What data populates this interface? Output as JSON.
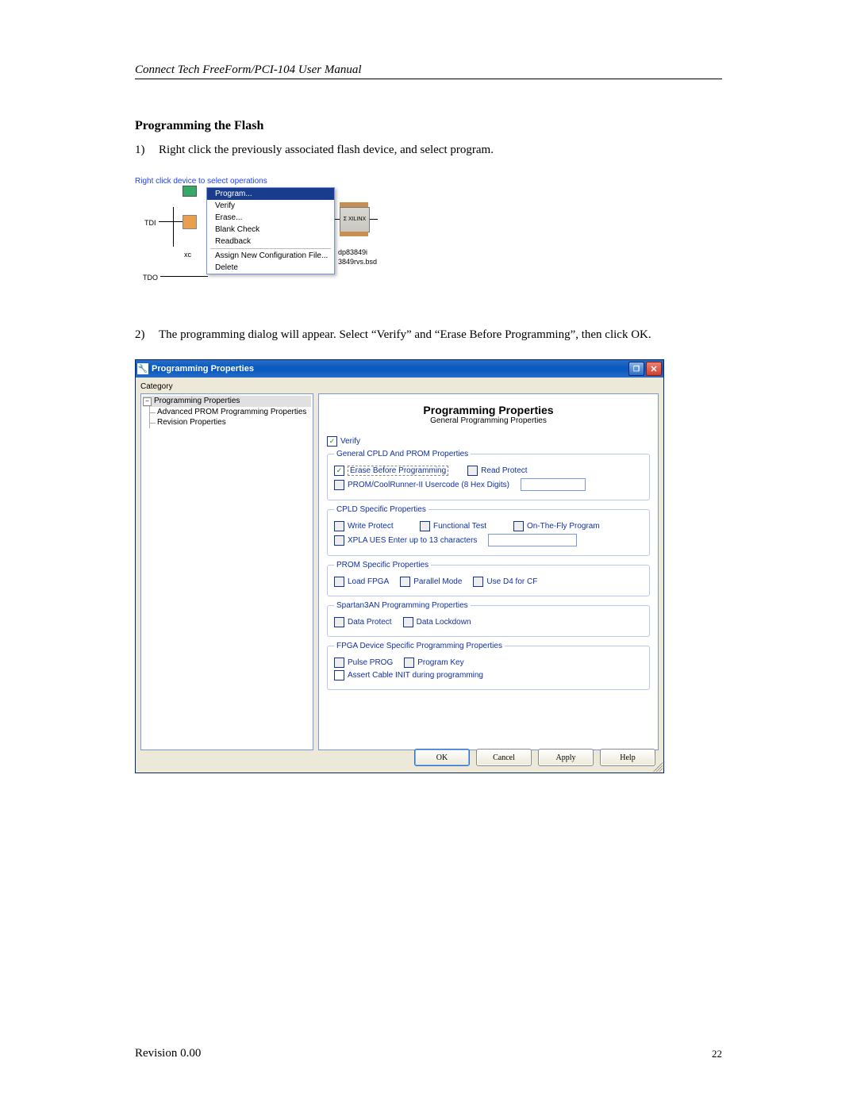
{
  "doc": {
    "header": "Connect Tech FreeForm/PCI-104 User Manual",
    "section_title": "Programming the Flash",
    "steps": [
      {
        "num": "1)",
        "text": "Right click the previously associated flash device, and select program."
      },
      {
        "num": "2)",
        "text": "The programming dialog will appear.  Select “Verify” and “Erase Before Programming”, then click OK."
      }
    ],
    "footer_left": "Revision 0.00",
    "footer_right": "22"
  },
  "shot1": {
    "hint": "Right click device to select operations",
    "tdi": "TDI",
    "tdo": "TDO",
    "xc": "xc",
    "xilinx": "Σ XILINX",
    "chip_labels": [
      "dp83849i",
      "3849rvs.bsd"
    ],
    "menu": [
      "Program...",
      "Verify",
      "Erase...",
      "Blank Check",
      "Readback",
      "Assign New Configuration File...",
      "Delete"
    ],
    "menu_highlight_index": 0
  },
  "dialog": {
    "title": "Programming Properties",
    "category_label": "Category",
    "tree": {
      "root": "Programming Properties",
      "children": [
        "Advanced PROM Programming Properties",
        "Revision Properties"
      ]
    },
    "pane_title": "Programming Properties",
    "pane_sub": "General Programming Properties",
    "verify_label": "Verify",
    "groups": {
      "cpld_prom": {
        "legend": "General CPLD And PROM Properties",
        "erase_before": "Erase Before Programming",
        "read_protect": "Read Protect",
        "usercode": "PROM/CoolRunner-II Usercode (8 Hex Digits)"
      },
      "cpld": {
        "legend": "CPLD Specific Properties",
        "write_protect": "Write Protect",
        "functional_test": "Functional Test",
        "on_the_fly": "On-The-Fly Program",
        "xpla": "XPLA UES Enter up to 13 characters"
      },
      "prom": {
        "legend": "PROM Specific Properties",
        "load_fpga": "Load FPGA",
        "parallel": "Parallel Mode",
        "d4": "Use D4 for CF"
      },
      "s3an": {
        "legend": "Spartan3AN Programming Properties",
        "data_protect": "Data Protect",
        "data_lockdown": "Data Lockdown"
      },
      "fpga": {
        "legend": "FPGA Device Specific Programming Properties",
        "pulse_prog": "Pulse PROG",
        "program_key": "Program Key",
        "assert_init": "Assert Cable INIT during programming"
      }
    },
    "buttons": {
      "ok": "OK",
      "cancel": "Cancel",
      "apply": "Apply",
      "help": "Help"
    }
  }
}
